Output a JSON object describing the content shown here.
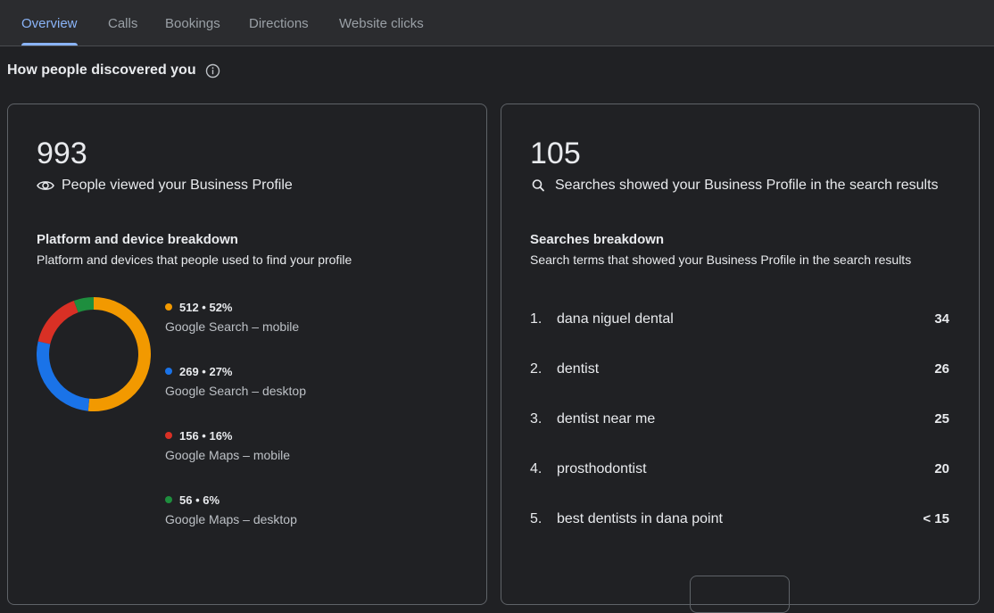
{
  "tabs": [
    {
      "label": "Overview",
      "active": true
    },
    {
      "label": "Calls",
      "active": false
    },
    {
      "label": "Bookings",
      "active": false
    },
    {
      "label": "Directions",
      "active": false
    },
    {
      "label": "Website clicks",
      "active": false
    }
  ],
  "heading": "How people discovered you",
  "views_card": {
    "number": "993",
    "caption": "People viewed your Business Profile",
    "breakdown_title": "Platform and device breakdown",
    "breakdown_subtitle": "Platform and devices that people used to find your profile",
    "legend": [
      {
        "value": "512 • 52%",
        "label": "Google Search – mobile",
        "color": "#f29900",
        "count": 512
      },
      {
        "value": "269 • 27%",
        "label": "Google Search – desktop",
        "color": "#1a73e8",
        "count": 269
      },
      {
        "value": "156 • 16%",
        "label": "Google Maps – mobile",
        "color": "#d93025",
        "count": 156
      },
      {
        "value": "56 • 6%",
        "label": "Google Maps – desktop",
        "color": "#1e8e3e",
        "count": 56
      }
    ]
  },
  "searches_card": {
    "number": "105",
    "caption": "Searches showed your Business Profile in the search results",
    "breakdown_title": "Searches breakdown",
    "breakdown_subtitle": "Search terms that showed your Business Profile in the search results",
    "terms": [
      {
        "rank": "1.",
        "term": "dana niguel dental",
        "count": "34"
      },
      {
        "rank": "2.",
        "term": "dentist",
        "count": "26"
      },
      {
        "rank": "3.",
        "term": "dentist near me",
        "count": "25"
      },
      {
        "rank": "4.",
        "term": "prosthodontist",
        "count": "20"
      },
      {
        "rank": "5.",
        "term": "best dentists in dana point",
        "count": "< 15"
      }
    ]
  },
  "colors": {
    "background": "#202124",
    "accent": "#8ab4f8",
    "border": "#5f6368"
  }
}
